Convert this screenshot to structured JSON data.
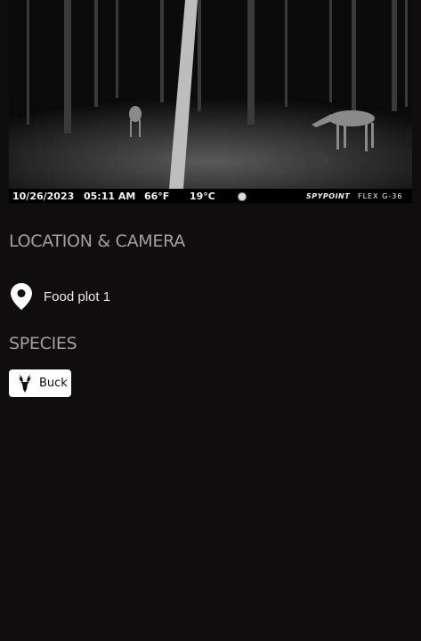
{
  "photo": {
    "date": "10/26/2023",
    "time": "05:11  AM",
    "temp_f": "66°F",
    "temp_c": "19°C",
    "moon_icon": "moon-phase-icon",
    "brand": "SPYPOINT",
    "model": "FLEX G-36"
  },
  "location_section": {
    "title": "LOCATION & CAMERA",
    "icon": "map-pin-icon",
    "location_name": "Food plot 1"
  },
  "species_section": {
    "title": "SPECIES",
    "chip_icon": "deer-head-icon",
    "chip_label": "Buck"
  },
  "colors": {
    "background": "#110d0e",
    "section_title": "#a39e9f",
    "chip_bg": "#ffffff"
  }
}
